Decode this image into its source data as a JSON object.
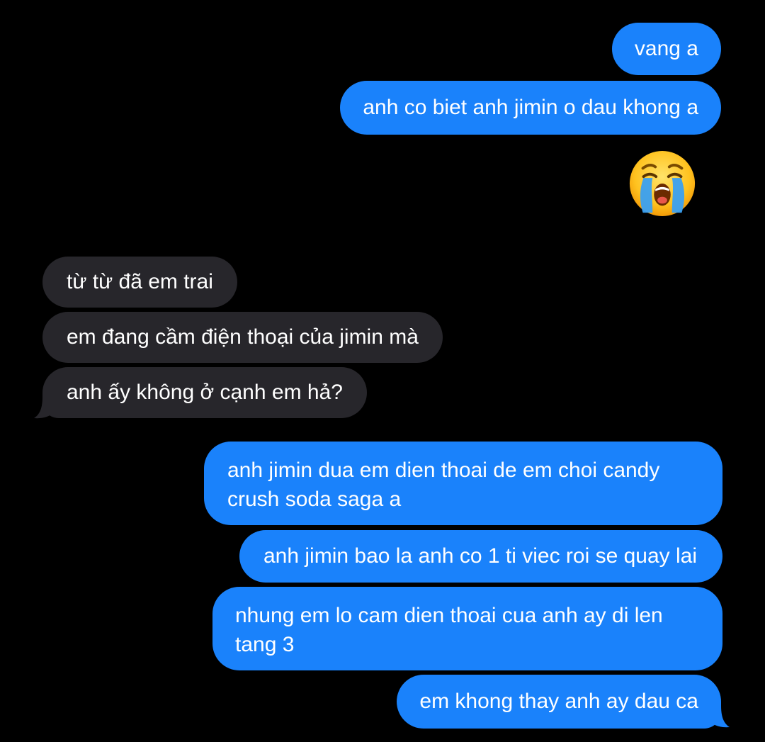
{
  "conversation": {
    "messages": [
      {
        "from": "me",
        "text": "vang a"
      },
      {
        "from": "me",
        "text": "anh co biet anh jimin o dau khong a"
      },
      {
        "from": "me",
        "emoji": "loudly-crying-face"
      },
      {
        "from": "them",
        "text": "từ từ đã em trai"
      },
      {
        "from": "them",
        "text": "em đang cầm điện thoại của jimin mà"
      },
      {
        "from": "them",
        "text": "anh ấy không ở cạnh em hả?"
      },
      {
        "from": "me",
        "text": "anh jimin dua em dien thoai de em choi candy crush soda saga a"
      },
      {
        "from": "me",
        "text": "anh jimin bao la anh co 1 ti viec roi se quay lai"
      },
      {
        "from": "me",
        "text": "nhung em lo cam dien thoai cua anh ay di len tang 3"
      },
      {
        "from": "me",
        "text": "em khong thay anh ay dau ca"
      }
    ]
  },
  "colors": {
    "background": "#000000",
    "sent_bubble": "#1a82fb",
    "received_bubble": "#27262b",
    "text": "#ffffff"
  }
}
